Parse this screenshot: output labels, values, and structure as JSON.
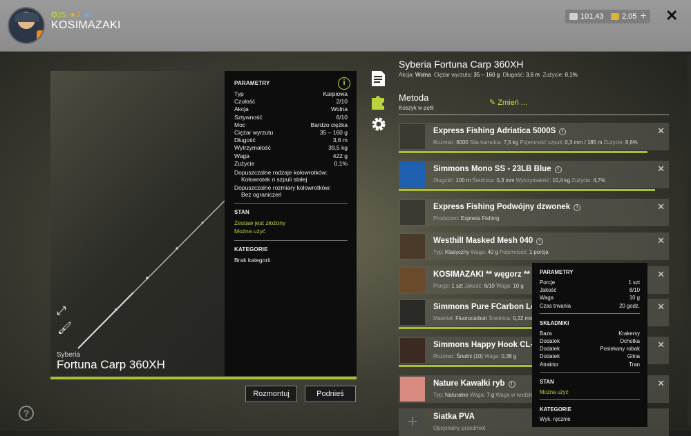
{
  "header": {
    "stats": [
      "25",
      "7",
      "1"
    ],
    "username": "KOSIMAZAKI",
    "silver": "101,43",
    "gold": "2,05",
    "plus_label": "+",
    "close_label": "✕"
  },
  "rod": {
    "brand": "Syberia",
    "name": "Fortuna Carp 360XH"
  },
  "params": {
    "heading": "PARAMETRY",
    "rows": [
      {
        "k": "Typ",
        "v": "Karpiowa"
      },
      {
        "k": "Czułość",
        "v": "2/10"
      },
      {
        "k": "Akcja",
        "v": "Wolna"
      },
      {
        "k": "Sztywność",
        "v": "6/10"
      },
      {
        "k": "Moc",
        "v": "Bardzo ciężka"
      },
      {
        "k": "Ciężar wyrzutu",
        "v": "35 – 160 g"
      },
      {
        "k": "Długość",
        "v": "3,6 m"
      },
      {
        "k": "Wytrzymałość",
        "v": "39,5 kg"
      },
      {
        "k": "Waga",
        "v": "422 g"
      },
      {
        "k": "Zużycie",
        "v": "0,1%"
      }
    ],
    "reel_types_label": "Dopuszczalne rodzaje kołowrotków:",
    "reel_types_value": "Kołowrotek o szpuli stałej",
    "reel_sizes_label": "Dopuszczalne rozmiary kołowrotków:",
    "reel_sizes_value": "Bez ograniczeń",
    "state_heading": "STAN",
    "state_1": "Zestaw jest złożony",
    "state_2": "Można użyć",
    "cat_heading": "KATEGORIE",
    "cat_value": "Brak kategorii"
  },
  "buttons": {
    "dismantle": "Rozmontuj",
    "lift": "Podnieś"
  },
  "help_label": "?",
  "right": {
    "title": "Syberia Fortuna Carp 360XH",
    "sub": {
      "akcja_k": "Akcja:",
      "akcja_v": "Wolna",
      "ciezar_k": "Ciężar wyrzutu:",
      "ciezar_v": "35 – 160 g",
      "dlugosc_k": "Długość:",
      "dlugosc_v": "3,6 m",
      "zuzycie_k": "Zużycie:",
      "zuzycie_v": "0,1%"
    },
    "method": "Metoda",
    "method_sub": "Koszyk w pętli",
    "change": "Zmień ..."
  },
  "items": [
    {
      "name": "Express Fishing Adriatica 5000S",
      "det": [
        [
          "Rozmiar:",
          "6000"
        ],
        [
          "Siła hamulca:",
          "7,5 kg"
        ],
        [
          "Pojemność szpuli:",
          "0,3 mm / 185 m"
        ],
        [
          "Zużycie:",
          "8,6%"
        ]
      ],
      "bar": 0.92
    },
    {
      "name": "Simmons Mono SS - 23LB Blue",
      "det": [
        [
          "Długość:",
          "100 m"
        ],
        [
          "Średnica:",
          "0,3 mm"
        ],
        [
          "Wytrzymałość:",
          "10,4 kg"
        ],
        [
          "Zużycie:",
          "4,7%"
        ]
      ],
      "bar": 0.95
    },
    {
      "name": "Express Fishing Podwójny dzwonek",
      "det": [
        [
          "Producent:",
          "Express Fishing"
        ]
      ],
      "bar": 0
    },
    {
      "name": "Westhill Masked Mesh 040",
      "det": [
        [
          "Typ:",
          "Klasyczny"
        ],
        [
          "Waga:",
          "40 g"
        ],
        [
          "Pojemność:",
          "1 porcja"
        ]
      ],
      "bar": 0
    },
    {
      "name": "KOSIMAZAKI ** węgorz **",
      "det": [
        [
          "Porcje:",
          "1 szt"
        ],
        [
          "Jakość:",
          "8/10"
        ],
        [
          "Waga:",
          "10 g"
        ]
      ],
      "bar": 0
    },
    {
      "name": "Simmons Pure FCarbon Leader",
      "det": [
        [
          "Materiał:",
          "Fluorocarbon"
        ],
        [
          "Średnica:",
          "0,32 mm"
        ]
      ],
      "bar": 0.5
    },
    {
      "name": "Simmons Happy Hook CL-12",
      "det": [
        [
          "Rozmiar:",
          "Średni (10)"
        ],
        [
          "Waga:",
          "0,38 g"
        ]
      ],
      "bar": 0.5
    },
    {
      "name": "Nature Kawałki ryb",
      "det": [
        [
          "Typ:",
          "Naturalne"
        ],
        [
          "Waga:",
          "7 g"
        ],
        [
          "Waga w wodzie",
          ""
        ]
      ],
      "bar": 0
    },
    {
      "name": "Siatka PVA",
      "det": [
        [
          "Opcjonalny przedmiot",
          ""
        ]
      ],
      "bar": 0
    }
  ],
  "tooltip": {
    "params_heading": "PARAMETRY",
    "params": [
      {
        "k": "Porcje",
        "v": "1 szt"
      },
      {
        "k": "Jakość",
        "v": "8/10"
      },
      {
        "k": "Waga",
        "v": "10 g"
      },
      {
        "k": "Czas trwania",
        "v": "20 godz."
      }
    ],
    "ingr_heading": "SKŁADNIKI",
    "ingr": [
      {
        "k": "Baza",
        "v": "Krakersy"
      },
      {
        "k": "Dodatek",
        "v": "Ochotka"
      },
      {
        "k": "Dodatek",
        "v": "Posiekany robak"
      },
      {
        "k": "Dodatek",
        "v": "Glina"
      },
      {
        "k": "Atraktor",
        "v": "Tran"
      }
    ],
    "state_heading": "STAN",
    "state": "Można użyć",
    "cat_heading": "KATEGORIE",
    "cat": "Wyk. ręcznie"
  },
  "colors": {
    "accent": "#a6c232",
    "green_text": "#b8d43a"
  }
}
